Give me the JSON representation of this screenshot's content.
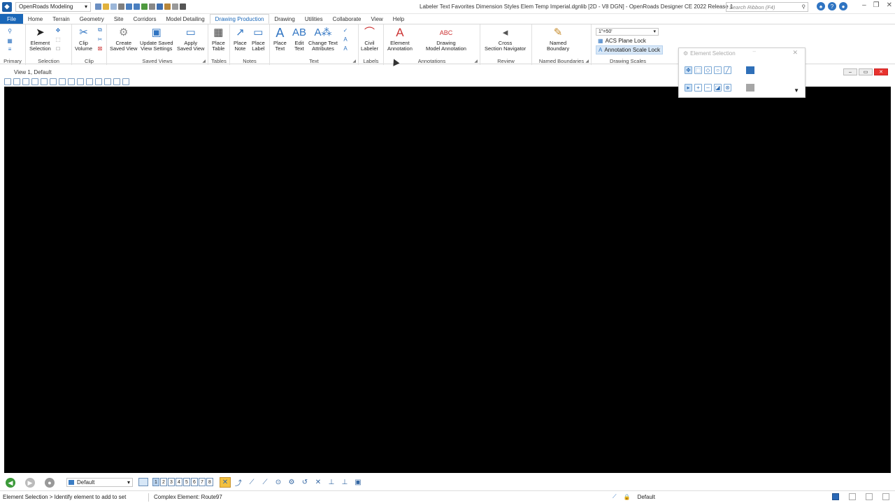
{
  "titlebar": {
    "workflow": "OpenRoads Modeling",
    "window_title": "Labeler Text Favorites Dimension Styles Elem Temp Imperial.dgnlib [2D - V8 DGN] - OpenRoads Designer CE 2022 Release 1",
    "search_placeholder": "Search Ribbon (F4)"
  },
  "tabs": [
    {
      "label": "File"
    },
    {
      "label": "Home"
    },
    {
      "label": "Terrain"
    },
    {
      "label": "Geometry"
    },
    {
      "label": "Site"
    },
    {
      "label": "Corridors"
    },
    {
      "label": "Model Detailing"
    },
    {
      "label": "Drawing Production"
    },
    {
      "label": "Drawing"
    },
    {
      "label": "Utilities"
    },
    {
      "label": "Collaborate"
    },
    {
      "label": "View"
    },
    {
      "label": "Help"
    }
  ],
  "ribbon": {
    "groups": {
      "primary": "Primary",
      "selection": "Selection",
      "clip": "Clip",
      "saved_views": "Saved Views",
      "tables": "Tables",
      "notes": "Notes",
      "text": "Text",
      "labels": "Labels",
      "annotations": "Annotations",
      "review": "Review",
      "named_boundaries": "Named Boundaries",
      "drawing_scales": "Drawing Scales"
    },
    "buttons": {
      "element_selection_1": "Element",
      "element_selection_2": "Selection",
      "clip_volume_1": "Clip",
      "clip_volume_2": "Volume",
      "create_saved_view_1": "Create",
      "create_saved_view_2": "Saved View",
      "update_saved_view_1": "Update Saved",
      "update_saved_view_2": "View Settings",
      "apply_saved_view_1": "Apply",
      "apply_saved_view_2": "Saved View",
      "place_table_1": "Place",
      "place_table_2": "Table",
      "place_note_1": "Place",
      "place_note_2": "Note",
      "place_label_1": "Place",
      "place_label_2": "Label",
      "place_text_1": "Place",
      "place_text_2": "Text",
      "edit_text_1": "Edit",
      "edit_text_2": "Text",
      "change_text_attr_1": "Change Text",
      "change_text_attr_2": "Attributes",
      "civil_labeler_1": "Civil",
      "civil_labeler_2": "Labeler",
      "element_annotation_1": "Element",
      "element_annotation_2": "Annotation",
      "drawing_model_annotation_1": "Drawing",
      "drawing_model_annotation_2": "Model Annotation",
      "cross_section_nav_1": "Cross",
      "cross_section_nav_2": "Section Navigator",
      "named_boundary_1": "Named",
      "named_boundary_2": "Boundary"
    },
    "drawing_scale_value": "1\"=50'",
    "acs_plane_lock": "ACS Plane Lock",
    "annotation_scale_lock": "Annotation Scale Lock"
  },
  "view": {
    "title": "View 1, Default"
  },
  "element_selection_dialog": {
    "title": "Element Selection"
  },
  "bottom": {
    "model": "Default",
    "views": [
      "1",
      "2",
      "3",
      "4",
      "5",
      "6",
      "7",
      "8"
    ]
  },
  "status": {
    "prompt": "Element Selection > Identify element to add to set",
    "message": "Complex Element: Route97",
    "level": "Default"
  }
}
